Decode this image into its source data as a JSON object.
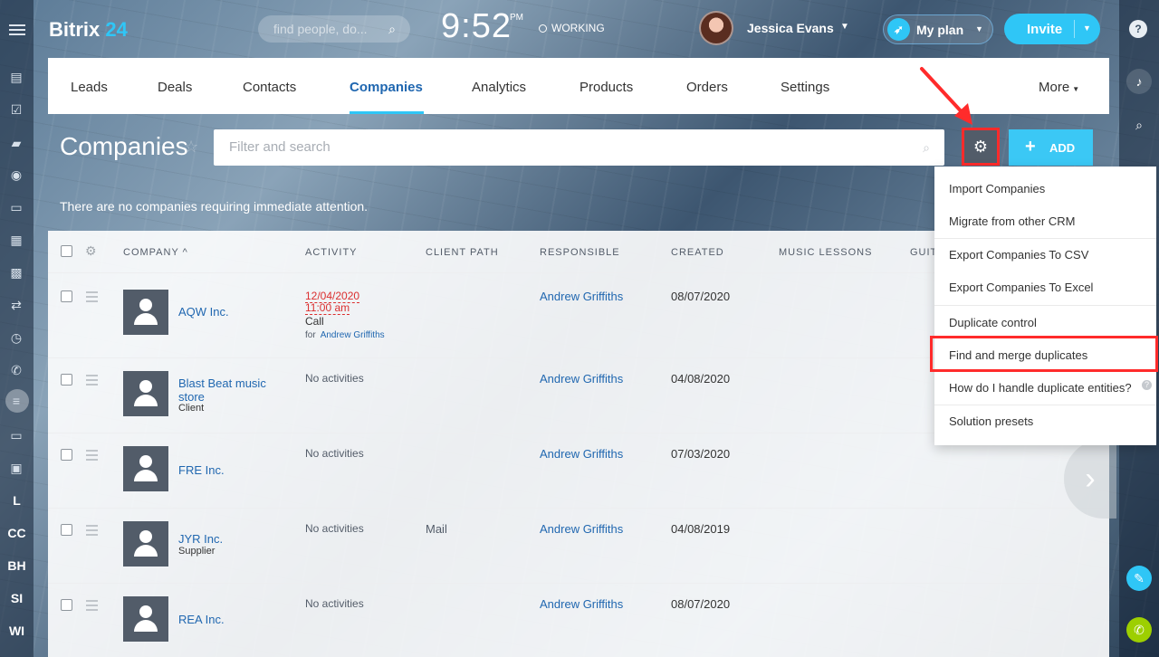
{
  "header": {
    "logo_word": "Bitrix",
    "logo_num": "24",
    "search_placeholder": "find people, do...",
    "time": "9:52",
    "time_suffix": "PM",
    "status": "WORKING",
    "user_name": "Jessica Evans",
    "plan_label": "My plan",
    "invite_label": "Invite",
    "help": "?"
  },
  "tabs": [
    "Leads",
    "Deals",
    "Contacts",
    "Companies",
    "Analytics",
    "Products",
    "Orders",
    "Settings",
    "More"
  ],
  "page": {
    "title": "Companies",
    "filter_placeholder": "Filter and search",
    "add_label": "ADD",
    "notice": "There are no companies requiring immediate attention."
  },
  "grid": {
    "columns": [
      "COMPANY",
      "ACTIVITY",
      "CLIENT PATH",
      "RESPONSIBLE",
      "CREATED",
      "MUSIC LESSONS",
      "GUIT"
    ],
    "rows": [
      {
        "name": "AQW Inc.",
        "type": "",
        "activity": "",
        "client_path": "",
        "responsible": "Andrew Griffiths",
        "created": "08/07/2020"
      },
      {
        "name": "Blast Beat music store",
        "type": "Client",
        "activity": "No activities",
        "client_path": "",
        "responsible": "Andrew Griffiths",
        "created": "04/08/2020"
      },
      {
        "name": "FRE Inc.",
        "type": "",
        "activity": "No activities",
        "client_path": "",
        "responsible": "Andrew Griffiths",
        "created": "07/03/2020"
      },
      {
        "name": "JYR Inc.",
        "type": "Supplier",
        "activity": "No activities",
        "client_path": "Mail",
        "responsible": "Andrew Griffiths",
        "created": "04/08/2019"
      },
      {
        "name": "REA Inc.",
        "type": "",
        "activity": "No activities",
        "client_path": "",
        "responsible": "Andrew Griffiths",
        "created": "08/07/2020"
      }
    ],
    "first_activity": {
      "date": "12/04/2020",
      "time": "11:00 am",
      "type": "Call",
      "for_prefix": "for",
      "for_name": "Andrew Griffiths"
    }
  },
  "dropdown": {
    "items": [
      "Import Companies",
      "Migrate from other CRM",
      "Export Companies To CSV",
      "Export Companies To Excel",
      "Duplicate control",
      "Find and merge duplicates",
      "How do I handle duplicate entities?",
      "Solution presets"
    ]
  },
  "sidebar_labels": [
    "L",
    "CC",
    "BH",
    "SI",
    "WI"
  ],
  "colors": {
    "accent": "#2fc6f6",
    "link": "#2067b0",
    "highlight": "#ff2b2b",
    "gear_bg": "#525c69"
  }
}
